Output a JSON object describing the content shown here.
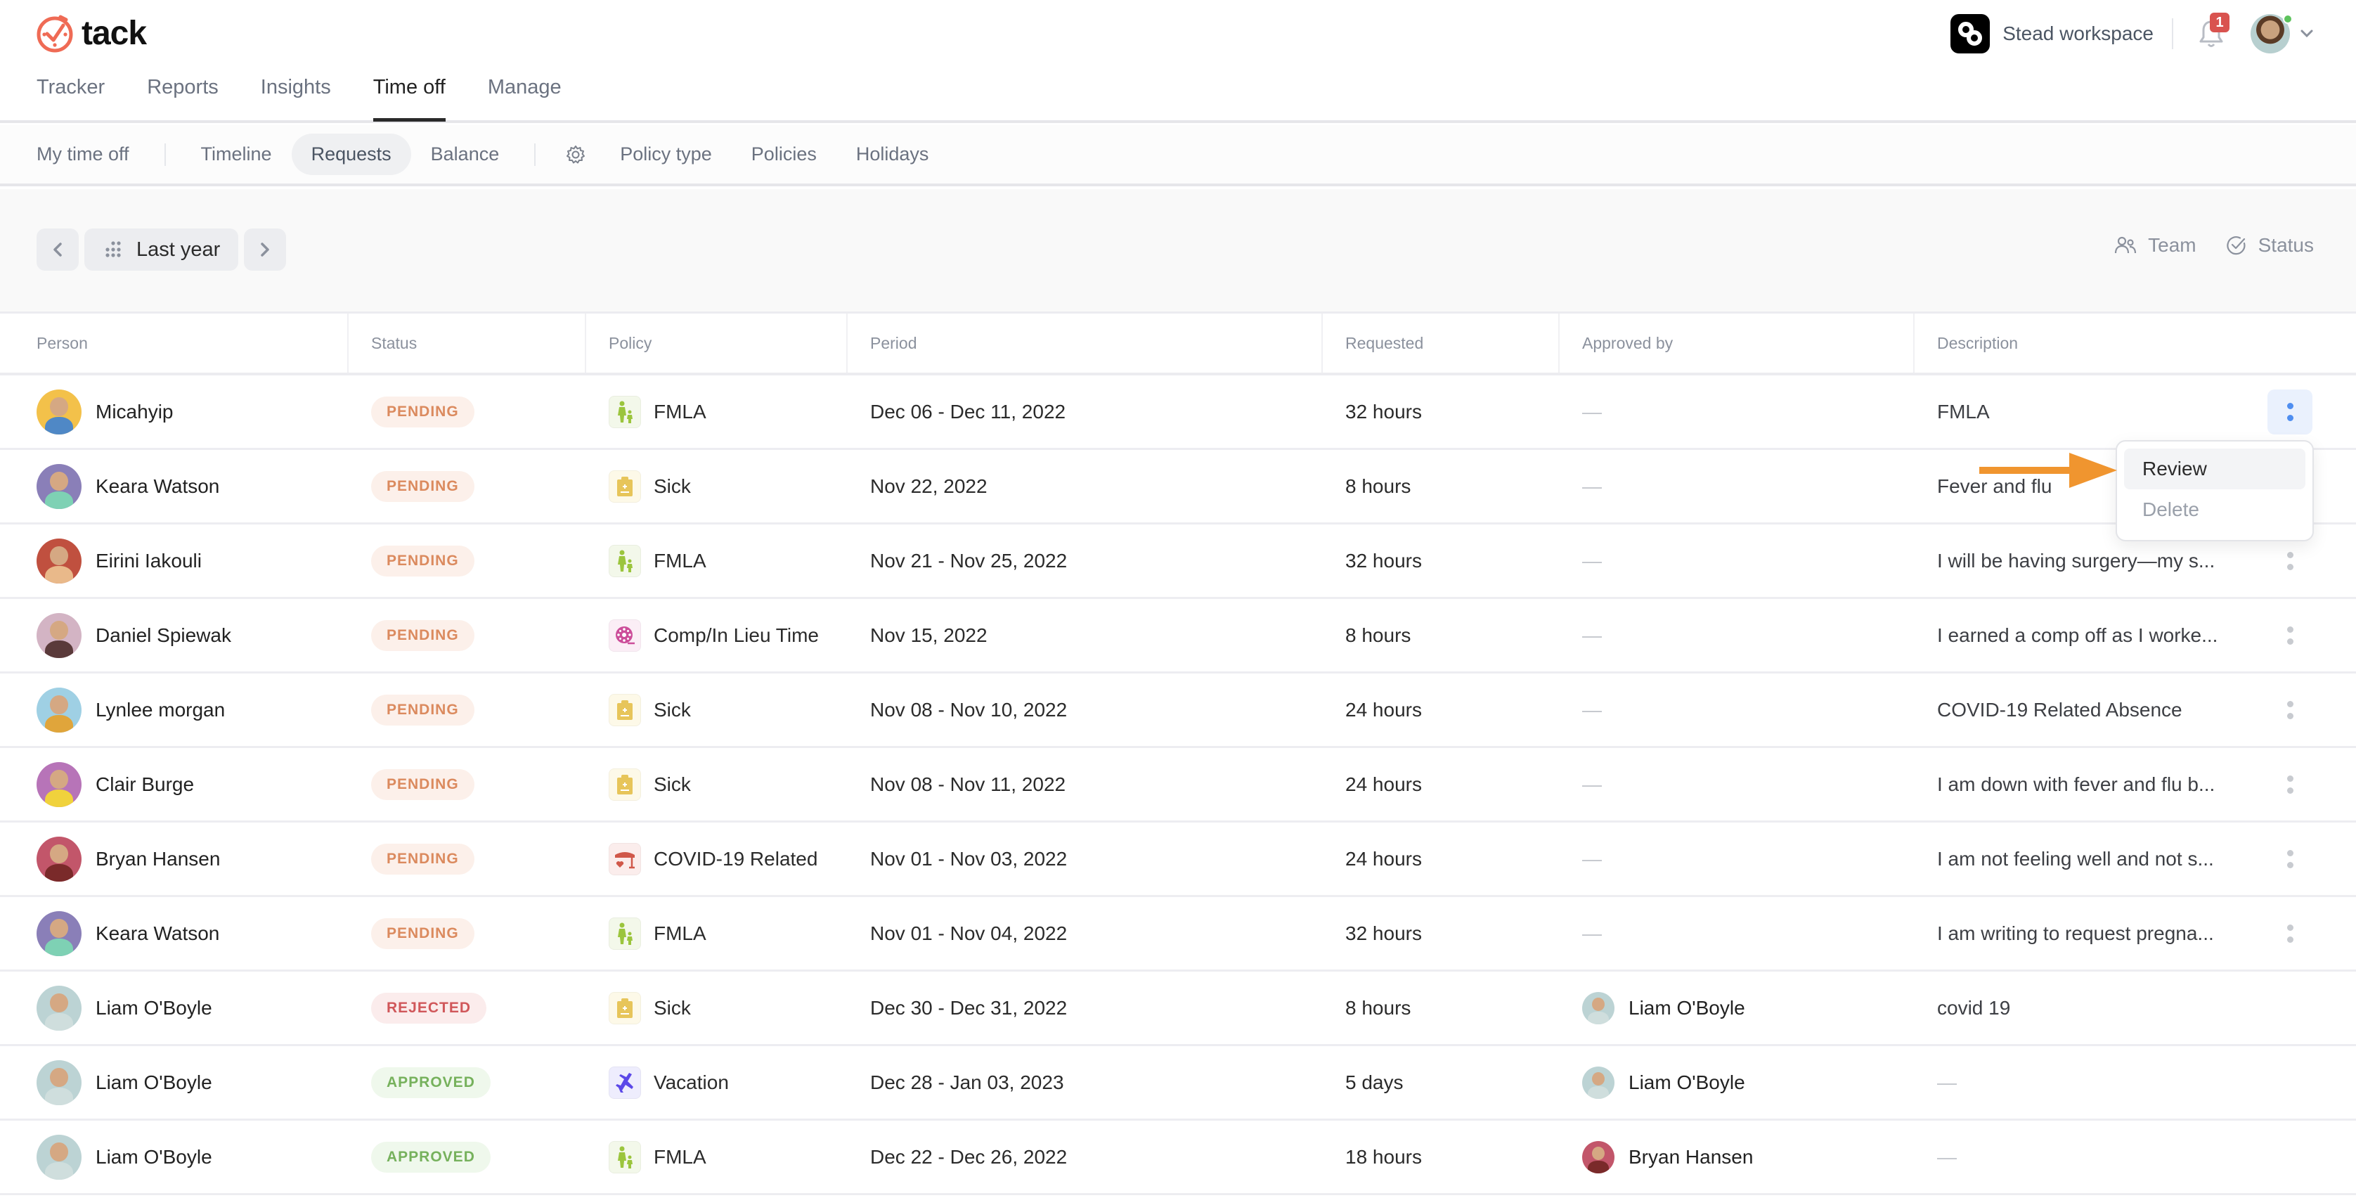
{
  "app": {
    "name": "tack",
    "brand_color": "#EF6B55"
  },
  "header": {
    "main_tabs": [
      {
        "label": "Tracker",
        "active": false
      },
      {
        "label": "Reports",
        "active": false
      },
      {
        "label": "Insights",
        "active": false
      },
      {
        "label": "Time off",
        "active": true
      },
      {
        "label": "Manage",
        "active": false
      }
    ],
    "workspace": {
      "name": "Stead workspace",
      "icon": "workspace-logo-icon"
    },
    "notifications": {
      "icon": "bell-icon",
      "count": "1"
    },
    "user": {
      "icon": "user-avatar",
      "online": true
    }
  },
  "subnav": {
    "items": [
      {
        "label": "My time off",
        "active": false
      },
      {
        "label": "Timeline",
        "active": false
      },
      {
        "label": "Requests",
        "active": true
      },
      {
        "label": "Balance",
        "active": false
      },
      {
        "label": "Policy type",
        "active": false
      },
      {
        "label": "Policies",
        "active": false
      },
      {
        "label": "Holidays",
        "active": false
      }
    ],
    "settings_icon": "gear-icon"
  },
  "filterbar": {
    "range_label": "Last year",
    "prev_icon": "chevron-left-icon",
    "next_icon": "chevron-right-icon",
    "filters": [
      {
        "label": "Team",
        "icon": "users-icon"
      },
      {
        "label": "Status",
        "icon": "check-circle-icon"
      }
    ]
  },
  "table": {
    "columns": [
      "Person",
      "Status",
      "Policy",
      "Period",
      "Requested",
      "Approved by",
      "Description"
    ],
    "rows": [
      {
        "person": "Micahyip",
        "status": "PENDING",
        "policy": "FMLA",
        "period": "Dec 06 - Dec 11, 2022",
        "requested": "32 hours",
        "approved_by": "—",
        "description": "FMLA",
        "menu_open": true
      },
      {
        "person": "Keara Watson",
        "status": "PENDING",
        "policy": "Sick",
        "period": "Nov 22, 2022",
        "requested": "8 hours",
        "approved_by": "—",
        "description": "Fever and flu"
      },
      {
        "person": "Eirini Iakouli",
        "status": "PENDING",
        "policy": "FMLA",
        "period": "Nov 21 - Nov 25, 2022",
        "requested": "32 hours",
        "approved_by": "—",
        "description": "I will be having surgery—my s..."
      },
      {
        "person": "Daniel Spiewak",
        "status": "PENDING",
        "policy": "Comp/In Lieu Time",
        "period": "Nov 15, 2022",
        "requested": "8 hours",
        "approved_by": "—",
        "description": "I earned a comp off as I worke..."
      },
      {
        "person": "Lynlee morgan",
        "status": "PENDING",
        "policy": "Sick",
        "period": "Nov 08 - Nov 10, 2022",
        "requested": "24 hours",
        "approved_by": "—",
        "description": "COVID-19 Related Absence"
      },
      {
        "person": "Clair Burge",
        "status": "PENDING",
        "policy": "Sick",
        "period": "Nov 08 - Nov 11, 2022",
        "requested": "24 hours",
        "approved_by": "—",
        "description": "I am down with fever and flu b..."
      },
      {
        "person": "Bryan Hansen",
        "status": "PENDING",
        "policy": "COVID-19 Related",
        "period": "Nov 01 - Nov 03, 2022",
        "requested": "24 hours",
        "approved_by": "—",
        "description": "I am not feeling well and not s..."
      },
      {
        "person": "Keara Watson",
        "status": "PENDING",
        "policy": "FMLA",
        "period": "Nov 01 - Nov 04, 2022",
        "requested": "32 hours",
        "approved_by": "—",
        "description": "I am writing to request pregna..."
      },
      {
        "person": "Liam O'Boyle",
        "status": "REJECTED",
        "policy": "Sick",
        "period": "Dec 30 - Dec 31, 2022",
        "requested": "8 hours",
        "approved_by": "Liam O'Boyle",
        "description": "covid 19"
      },
      {
        "person": "Liam O'Boyle",
        "status": "APPROVED",
        "policy": "Vacation",
        "period": "Dec 28 - Jan 03, 2023",
        "requested": "5 days",
        "approved_by": "Liam O'Boyle",
        "description": "—"
      },
      {
        "person": "Liam O'Boyle",
        "status": "APPROVED",
        "policy": "FMLA",
        "period": "Dec 22 - Dec 26, 2022",
        "requested": "18 hours",
        "approved_by": "Bryan Hansen",
        "description": "—"
      }
    ]
  },
  "status_colors": {
    "PENDING": {
      "fg": "#DB8A5E",
      "bg": "#FCF0EA"
    },
    "REJECTED": {
      "fg": "#D0575A",
      "bg": "#FBECEC"
    },
    "APPROVED": {
      "fg": "#76B15C",
      "bg": "#EFF8EC"
    }
  },
  "policy_styles": {
    "FMLA": {
      "icon": "family-icon",
      "fg": "#9BC53D",
      "bg": "#F3F8EA"
    },
    "Sick": {
      "icon": "clipboard-medical-icon",
      "fg": "#E7C55A",
      "bg": "#FDF9E8"
    },
    "Comp/In Lieu Time": {
      "icon": "film-reel-icon",
      "fg": "#CC4E9A",
      "bg": "#FBEEF6"
    },
    "COVID-19 Related": {
      "icon": "shop-heart-icon",
      "fg": "#D0584A",
      "bg": "#FBEDEC"
    },
    "Vacation": {
      "icon": "airplane-icon",
      "fg": "#5B48E8",
      "bg": "#EEEDFD"
    }
  },
  "row_menu": {
    "items": [
      {
        "label": "Review",
        "enabled": true,
        "highlighted": true
      },
      {
        "label": "Delete",
        "enabled": false
      }
    ],
    "annotation": {
      "icon": "arrow-right-icon",
      "color": "#F0952F"
    }
  }
}
